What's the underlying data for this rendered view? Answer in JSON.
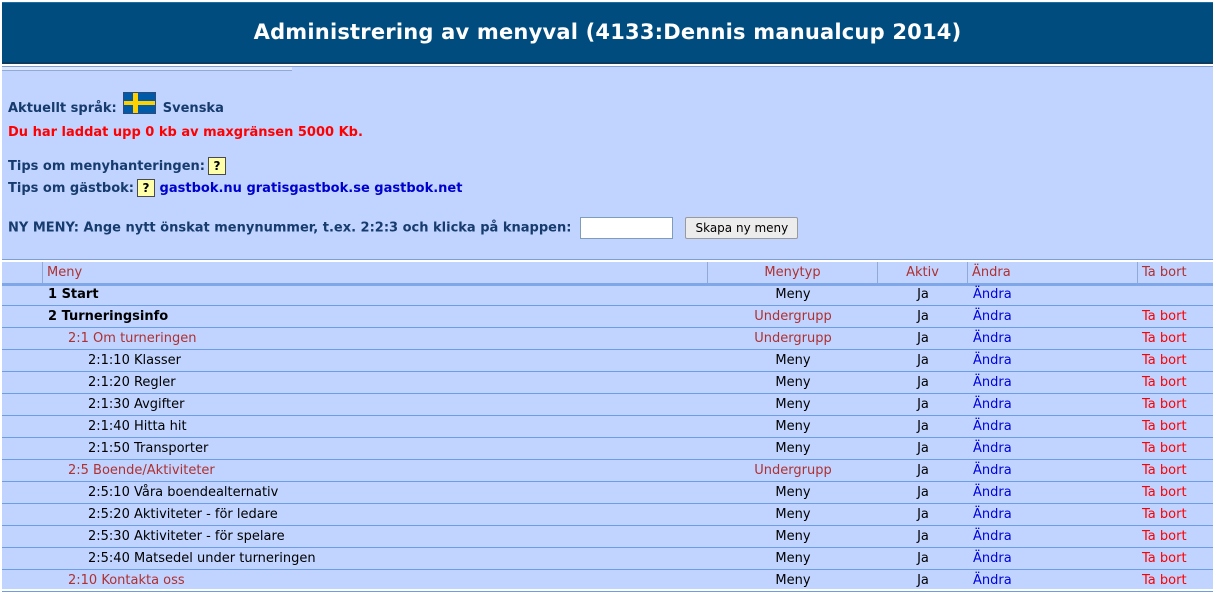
{
  "header": {
    "title": "Administrering av menyval (4133:Dennis manualcup 2014)"
  },
  "info": {
    "language_label": "Aktuellt språk:",
    "language_flag": "sweden-flag-icon",
    "language_name": "Svenska",
    "upload_notice": "Du har laddat upp 0 kb av maxgränsen 5000 Kb.",
    "tips_menu_label": "Tips om menyhanteringen:",
    "tips_guestbook_label": "Tips om gästbok:",
    "help_glyph": "?",
    "guestbook_links": [
      "gastbok.nu",
      "gratisgastbok.se",
      "gastbok.net"
    ],
    "new_menu_label": "NY MENY: Ange nytt önskat menynummer, t.ex. 2:2:3 och klicka på knappen:",
    "new_menu_value": "",
    "new_menu_button": "Skapa ny meny"
  },
  "table": {
    "columns": [
      "Meny",
      "Menytyp",
      "Aktiv",
      "Ändra",
      "Ta bort"
    ],
    "rows": [
      {
        "name": "1 Start",
        "level": 1,
        "type": "Meny",
        "active": "Ja",
        "edit": "Ändra",
        "delete": ""
      },
      {
        "name": "2 Turneringsinfo",
        "level": 1,
        "type": "Undergrupp",
        "active": "Ja",
        "edit": "Ändra",
        "delete": "Ta bort"
      },
      {
        "name": "2:1 Om turneringen",
        "level": 2,
        "type": "Undergrupp",
        "active": "Ja",
        "edit": "Ändra",
        "delete": "Ta bort"
      },
      {
        "name": "2:1:10 Klasser",
        "level": 3,
        "type": "Meny",
        "active": "Ja",
        "edit": "Ändra",
        "delete": "Ta bort"
      },
      {
        "name": "2:1:20 Regler",
        "level": 3,
        "type": "Meny",
        "active": "Ja",
        "edit": "Ändra",
        "delete": "Ta bort"
      },
      {
        "name": "2:1:30 Avgifter",
        "level": 3,
        "type": "Meny",
        "active": "Ja",
        "edit": "Ändra",
        "delete": "Ta bort"
      },
      {
        "name": "2:1:40 Hitta hit",
        "level": 3,
        "type": "Meny",
        "active": "Ja",
        "edit": "Ändra",
        "delete": "Ta bort"
      },
      {
        "name": "2:1:50 Transporter",
        "level": 3,
        "type": "Meny",
        "active": "Ja",
        "edit": "Ändra",
        "delete": "Ta bort"
      },
      {
        "name": "2:5 Boende/Aktiviteter",
        "level": 2,
        "type": "Undergrupp",
        "active": "Ja",
        "edit": "Ändra",
        "delete": "Ta bort"
      },
      {
        "name": "2:5:10 Våra boendealternativ",
        "level": 3,
        "type": "Meny",
        "active": "Ja",
        "edit": "Ändra",
        "delete": "Ta bort"
      },
      {
        "name": "2:5:20 Aktiviteter - för ledare",
        "level": 3,
        "type": "Meny",
        "active": "Ja",
        "edit": "Ändra",
        "delete": "Ta bort"
      },
      {
        "name": "2:5:30 Aktiviteter - för spelare",
        "level": 3,
        "type": "Meny",
        "active": "Ja",
        "edit": "Ändra",
        "delete": "Ta bort"
      },
      {
        "name": "2:5:40 Matsedel under turneringen",
        "level": 3,
        "type": "Meny",
        "active": "Ja",
        "edit": "Ändra",
        "delete": "Ta bort"
      },
      {
        "name": "2:10 Kontakta oss",
        "level": 2,
        "type": "Meny",
        "active": "Ja",
        "edit": "Ändra",
        "delete": "Ta bort"
      }
    ]
  }
}
